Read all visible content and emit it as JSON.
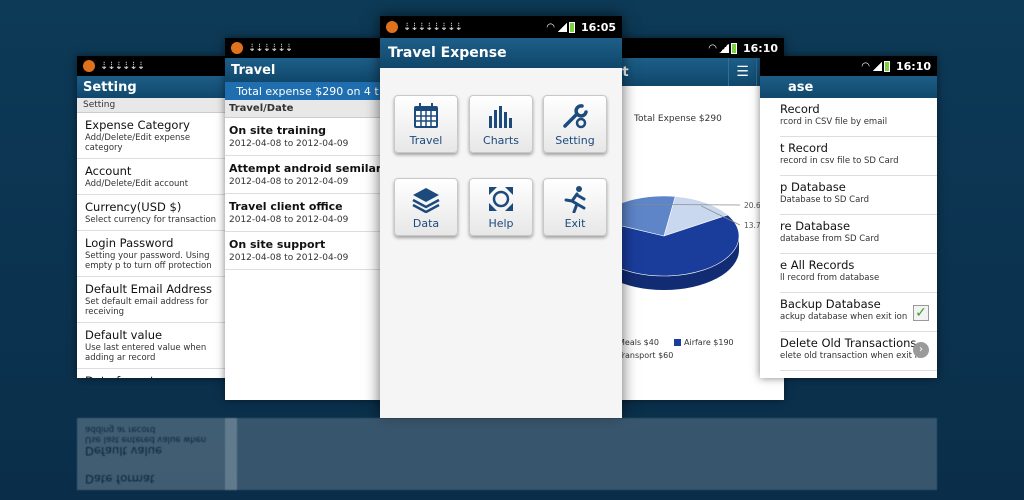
{
  "colors": {
    "page_bg": "#0b3350",
    "titlebar": "#1d5e88",
    "banner": "#1f6fb0",
    "menu_label": "#1c4a7c",
    "pie_meals": "#c9d8ef",
    "pie_airfare": "#1a3d9c",
    "pie_transport": "#5d85c8"
  },
  "settings_screen": {
    "status_bar_icon": "app-icon",
    "title": "Setting",
    "header": "Setting",
    "items": [
      {
        "title": "Expense Category",
        "subtitle": "Add/Delete/Edit expense category"
      },
      {
        "title": "Account",
        "subtitle": "Add/Delete/Edit account"
      },
      {
        "title": "Currency(USD $)",
        "subtitle": "Select currency for transaction"
      },
      {
        "title": "Login Password",
        "subtitle": "Setting your password. Using empty p to turn off protection"
      },
      {
        "title": "Default Email Address",
        "subtitle": "Set default email address for receiving"
      },
      {
        "title": "Default value",
        "subtitle": "Use last entered value when adding ar record"
      },
      {
        "title": "Date format",
        "subtitle": ""
      }
    ]
  },
  "travel_screen": {
    "title": "Travel",
    "banner": "Total expense $290 on 4 t",
    "column_header": "Travel/Date",
    "items": [
      {
        "title": "On site training",
        "dates": "2012-04-08 to 2012-04-09"
      },
      {
        "title": "Attempt android semilar",
        "dates": "2012-04-08 to 2012-04-09"
      },
      {
        "title": "Travel client office",
        "dates": "2012-04-08 to 2012-04-09"
      },
      {
        "title": "On site support",
        "dates": "2012-04-08 to 2012-04-09"
      }
    ]
  },
  "main_screen": {
    "time": "16:05",
    "title": "Travel Expense",
    "tiles": [
      {
        "label": "Travel",
        "icon": "calendar-icon"
      },
      {
        "label": "Charts",
        "icon": "bar-chart-icon"
      },
      {
        "label": "Setting",
        "icon": "wrench-icon"
      },
      {
        "label": "Data",
        "icon": "layers-icon"
      },
      {
        "label": "Help",
        "icon": "help-arrows-icon"
      },
      {
        "label": "Exit",
        "icon": "running-man-icon"
      }
    ]
  },
  "chart_screen": {
    "title_fragment": "rt",
    "menu_icon": "menu-icon",
    "help_icon": "help-icon",
    "chart_data": {
      "type": "pie",
      "title": "Total Expense $290",
      "slices": [
        {
          "name": "Meals",
          "label": "Meals $40",
          "value": 40,
          "percent_label": "13.79%"
        },
        {
          "name": "Airfare",
          "label": "Airfare $190",
          "value": 190,
          "percent_label": ""
        },
        {
          "name": "Transport",
          "label": "Transport $60",
          "value": 60,
          "percent_label": "20.69%"
        }
      ],
      "legend_position": "bottom"
    }
  },
  "backup_screen": {
    "time": "16:10",
    "title_fragment": "ase",
    "items": [
      {
        "title": "Record",
        "subtitle": "rcord in CSV file by email",
        "control": ""
      },
      {
        "title": "t Record",
        "subtitle": "record in csv file to SD Card",
        "control": ""
      },
      {
        "title": "p Database",
        "subtitle": "Database to SD Card",
        "control": ""
      },
      {
        "title": "re Database",
        "subtitle": "database from SD Card",
        "control": ""
      },
      {
        "title": "e All Records",
        "subtitle": "ll record from database",
        "control": ""
      },
      {
        "title": "Backup Database",
        "subtitle": "ackup database when exit ion",
        "control": "checkbox",
        "checked": true
      },
      {
        "title": "Delete Old Transactions",
        "subtitle": "elete old transaction when exit n",
        "control": "arrow"
      }
    ],
    "checkmark": "✓",
    "arrow_glyph": "›"
  },
  "status_time_other": "16:10"
}
